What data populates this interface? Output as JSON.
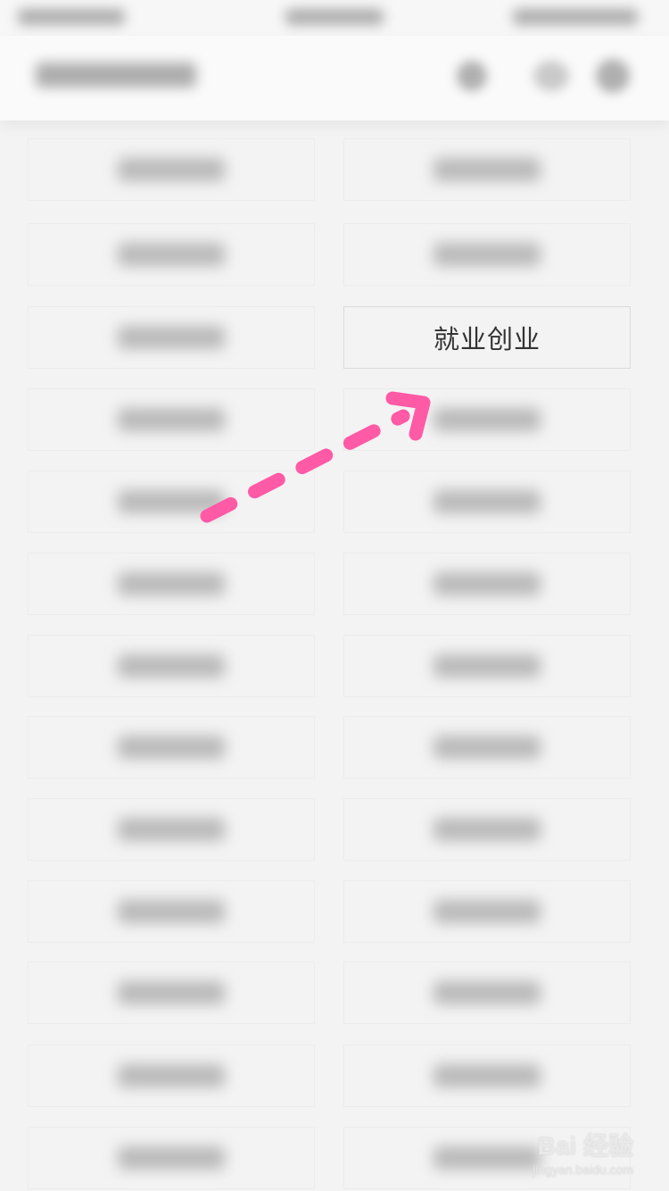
{
  "highlighted_tile": {
    "label": "就业创业"
  },
  "watermark": {
    "brand": "Bai 经验",
    "url": "jingyan.baidu.com"
  },
  "annotation": {
    "color": "#ff5aa6",
    "type": "dashed-arrow"
  },
  "left_column_count": 13,
  "right_column_count": 13
}
